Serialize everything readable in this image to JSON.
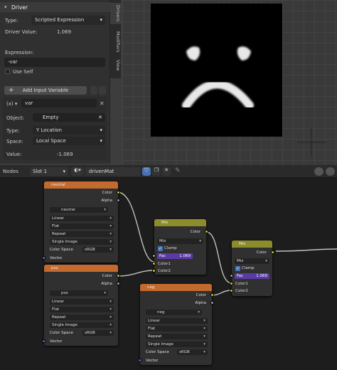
{
  "driver": {
    "title": "Driver",
    "type_label": "Type:",
    "type_value": "Scripted Expression",
    "value_label": "Driver Value:",
    "value": "1.069",
    "expr_label": "Expression:",
    "expr_value": "-var",
    "use_self": "Use Self",
    "add_var": "Add Input Variable",
    "var_name": "var",
    "object_label": "Object:",
    "object_value": "Empty",
    "var_type_label": "Type:",
    "var_type_value": "Y Location",
    "space_label": "Space:",
    "space_value": "Local Space",
    "var_value_label": "Value:",
    "var_value": "-1.069"
  },
  "tabs": [
    "Drivers",
    "Modifiers",
    "View"
  ],
  "header": {
    "nodes": "Nodes",
    "slot": "Slot 1",
    "material": "drivenMat"
  },
  "node_neutral": {
    "title": "neutral",
    "color": "Color",
    "alpha": "Alpha",
    "image": "neutral",
    "interp": "Linear",
    "proj": "Flat",
    "ext": "Repeat",
    "src": "Single Image",
    "cs_label": "Color Space",
    "cs": "sRGB",
    "vector": "Vector"
  },
  "node_pos": {
    "title": "pos",
    "color": "Color",
    "alpha": "Alpha",
    "image": "pos",
    "interp": "Linear",
    "proj": "Flat",
    "ext": "Repeat",
    "src": "Single Image",
    "cs_label": "Color Space",
    "cs": "sRGB",
    "vector": "Vector"
  },
  "node_neg": {
    "title": "neg",
    "color": "Color",
    "alpha": "Alpha",
    "image": "neg",
    "interp": "Linear",
    "proj": "Flat",
    "ext": "Repeat",
    "src": "Single Image",
    "cs_label": "Color Space",
    "cs": "sRGB",
    "vector": "Vector"
  },
  "mix1": {
    "title": "Mix",
    "color": "Color",
    "mode": "Mix",
    "clamp": "Clamp",
    "fac": "Fac",
    "fac_value": "1.069",
    "color1": "Color1",
    "color2": "Color2"
  },
  "mix2": {
    "title": "Mix",
    "color": "Color",
    "mode": "Mix",
    "clamp": "Clamp",
    "fac": "Fac",
    "fac_value": "1.069",
    "color1": "Color1",
    "color2": "Color2"
  },
  "colors": {
    "texture_header": "#c56a2e",
    "mix_header": "#8c8c2a",
    "accent": "#4772b3"
  }
}
